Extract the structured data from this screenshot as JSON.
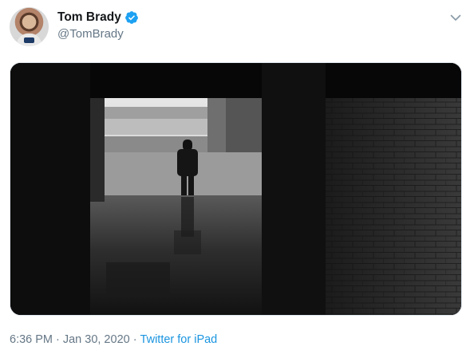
{
  "tweet": {
    "author_name": "Tom Brady",
    "handle": "@TomBrady",
    "verified": true,
    "time": "6:36 PM",
    "separator_1": "·",
    "date": "Jan 30, 2020",
    "separator_2": "·",
    "source": "Twitter for iPad"
  },
  "icons": {
    "verified": "verified-badge-icon",
    "menu": "chevron-down-icon"
  },
  "colors": {
    "verified_blue": "#1da1f2",
    "link_blue": "#1b95e0",
    "muted_text": "#657786",
    "name_text": "#14171a"
  }
}
